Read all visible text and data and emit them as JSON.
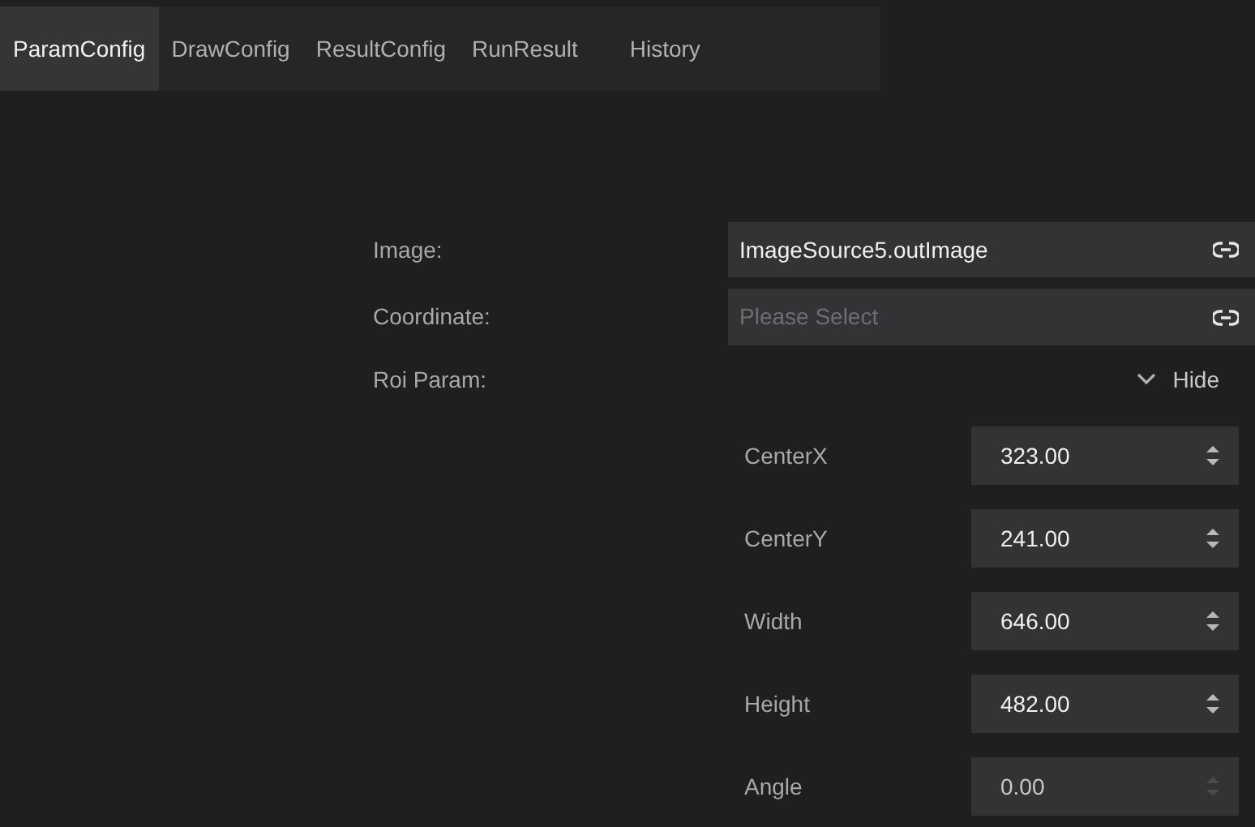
{
  "tabs": [
    {
      "label": "ParamConfig",
      "selected": true
    },
    {
      "label": "DrawConfig",
      "selected": false
    },
    {
      "label": "ResultConfig",
      "selected": false
    },
    {
      "label": "RunResult",
      "selected": false
    },
    {
      "label": "History",
      "selected": false
    }
  ],
  "image": {
    "label": "Image:",
    "value": "ImageSource5.outImage"
  },
  "coordinate": {
    "label": "Coordinate:",
    "placeholder": "Please Select"
  },
  "roi_param": {
    "label": "Roi Param:",
    "toggle": "Hide",
    "expanded": true,
    "fields": [
      {
        "label": "CenterX",
        "value": "323.00",
        "disabled": false
      },
      {
        "label": "CenterY",
        "value": "241.00",
        "disabled": false
      },
      {
        "label": "Width",
        "value": "646.00",
        "disabled": false
      },
      {
        "label": "Height",
        "value": "482.00",
        "disabled": false
      },
      {
        "label": "Angle",
        "value": "0.00",
        "disabled": true
      }
    ]
  }
}
